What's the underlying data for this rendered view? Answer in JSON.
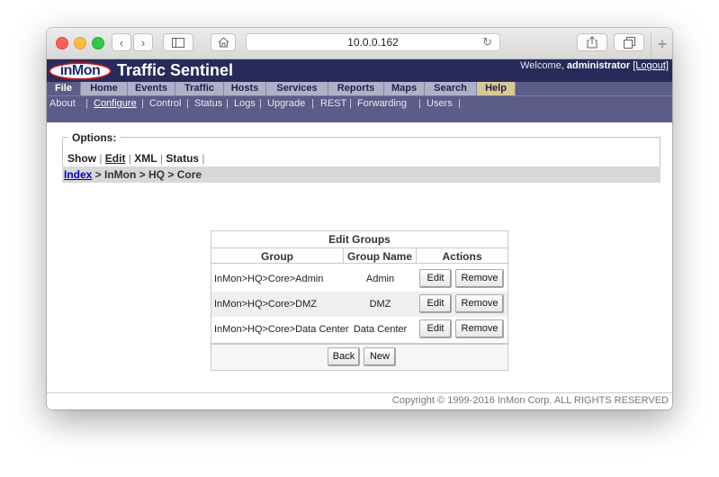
{
  "browser": {
    "url": "10.0.0.162",
    "back_icon": "chevron-left-icon",
    "forward_icon": "chevron-right-icon",
    "sidebar_icon": "sidebar-icon",
    "home_icon": "home-icon",
    "reload_icon": "reload-icon",
    "share_icon": "share-icon",
    "tabs_icon": "tabs-icon",
    "new_tab_icon": "plus-icon"
  },
  "app": {
    "logo_text": "inMon",
    "name": "Traffic Sentinel",
    "welcome_prefix": "Welcome, ",
    "user": "administrator",
    "logout_label": "[Logout]"
  },
  "menu": {
    "items": [
      "File",
      "Home",
      "Events",
      "Traffic",
      "Hosts",
      "Services",
      "Reports",
      "Maps",
      "Search",
      "Help"
    ],
    "active": "File"
  },
  "submenu": {
    "items": [
      "About",
      "Configure",
      "Control",
      "Status",
      "Logs",
      "Upgrade",
      "REST",
      "Forwarding",
      "Users"
    ],
    "active": "Configure"
  },
  "options": {
    "legend": "Options:",
    "links": [
      "Show",
      "Edit",
      "XML",
      "Status"
    ],
    "active": "Edit"
  },
  "breadcrumb": {
    "link": "Index",
    "rest": " > InMon > HQ > Core"
  },
  "table": {
    "title": "Edit Groups",
    "columns": [
      "Group",
      "Group Name",
      "Actions"
    ],
    "rows": [
      {
        "group": "InMon>HQ>Core>Admin",
        "name": "Admin"
      },
      {
        "group": "InMon>HQ>Core>DMZ",
        "name": "DMZ"
      },
      {
        "group": "InMon>HQ>Core>Data Center",
        "name": "Data Center"
      }
    ],
    "edit_label": "Edit",
    "remove_label": "Remove",
    "back_label": "Back",
    "new_label": "New"
  },
  "footer": "Copyright © 1999-2016 InMon Corp. ALL RIGHTS RESERVED"
}
